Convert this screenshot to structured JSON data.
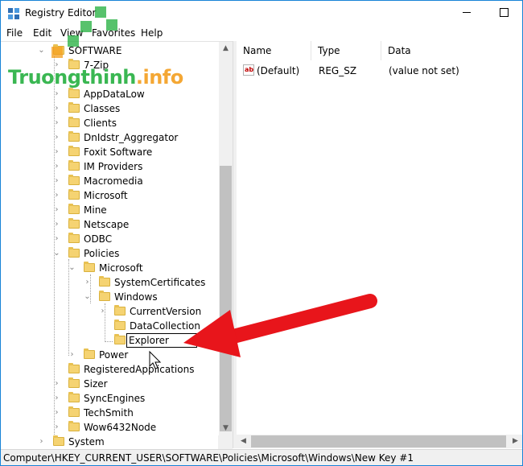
{
  "window": {
    "title": "Registry Editor",
    "icon": "registry-editor-icon",
    "controls": {
      "minimize": "minimize",
      "maximize": "maximize"
    }
  },
  "menu": {
    "items": [
      "File",
      "Edit",
      "View",
      "Favorites",
      "Help"
    ]
  },
  "tree": {
    "items": [
      {
        "label": "SOFTWARE",
        "depth": 0,
        "expanded": true
      },
      {
        "label": "7-Zip",
        "depth": 1,
        "expanded": false
      },
      {
        "label": "AppDataLow",
        "depth": 1,
        "expanded": false
      },
      {
        "label": "Classes",
        "depth": 1,
        "expanded": false
      },
      {
        "label": "Clients",
        "depth": 1,
        "expanded": false
      },
      {
        "label": "DnIdstr_Aggregator",
        "depth": 1,
        "expanded": false
      },
      {
        "label": "Foxit Software",
        "depth": 1,
        "expanded": false
      },
      {
        "label": "IM Providers",
        "depth": 1,
        "expanded": false
      },
      {
        "label": "Macromedia",
        "depth": 1,
        "expanded": false
      },
      {
        "label": "Microsoft",
        "depth": 1,
        "expanded": false
      },
      {
        "label": "Mine",
        "depth": 1,
        "expanded": false
      },
      {
        "label": "Netscape",
        "depth": 1,
        "expanded": false
      },
      {
        "label": "ODBC",
        "depth": 1,
        "expanded": false
      },
      {
        "label": "Policies",
        "depth": 1,
        "expanded": true
      },
      {
        "label": "Microsoft",
        "depth": 2,
        "expanded": true
      },
      {
        "label": "SystemCertificates",
        "depth": 3,
        "expanded": false
      },
      {
        "label": "Windows",
        "depth": 3,
        "expanded": true
      },
      {
        "label": "CurrentVersion",
        "depth": 4,
        "expanded": false
      },
      {
        "label": "DataCollection",
        "depth": 4,
        "expanded": false
      },
      {
        "label": "Explorer",
        "depth": 4,
        "editing": true
      },
      {
        "label": "Power",
        "depth": 2,
        "expanded": false
      },
      {
        "label": "RegisteredApplications",
        "depth": 1,
        "expanded": false
      },
      {
        "label": "Sizer",
        "depth": 1,
        "expanded": false
      },
      {
        "label": "SyncEngines",
        "depth": 1,
        "expanded": false
      },
      {
        "label": "TechSmith",
        "depth": 1,
        "expanded": false
      },
      {
        "label": "Wow6432Node",
        "depth": 1,
        "expanded": false
      },
      {
        "label": "System",
        "depth": 0,
        "expanded": false
      }
    ]
  },
  "list": {
    "columns": [
      "Name",
      "Type",
      "Data"
    ],
    "rows": [
      {
        "name": "(Default)",
        "type": "REG_SZ",
        "data": "(value not set)",
        "icon": "ab"
      }
    ]
  },
  "status": {
    "path": "Computer\\HKEY_CURRENT_USER\\SOFTWARE\\Policies\\Microsoft\\Windows\\New Key #1"
  },
  "watermark": {
    "text_main": "Truongthinh",
    "text_accent": ".info"
  },
  "colors": {
    "accent_border": "#1883d7",
    "folder": "#f5d372",
    "arrow_red": "#e8151b",
    "watermark_green": "#1fae3b",
    "watermark_orange": "#f39c19"
  }
}
